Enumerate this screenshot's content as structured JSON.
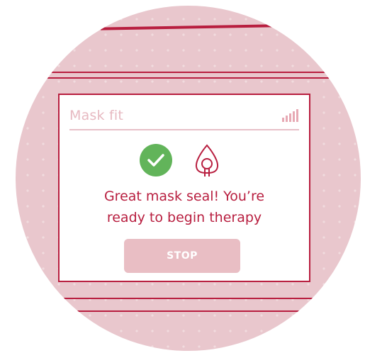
{
  "colors": {
    "accent": "#b81e3f",
    "success": "#62b45a",
    "backdrop": "#e9c7cd",
    "button_bg": "#e9bec4"
  },
  "panel": {
    "title": "Mask fit",
    "signal_icon": "signal-strength-icon",
    "status_icon": "check-circle-icon",
    "mask_icon": "mask-icon",
    "message_line1": "Great mask seal! You’re",
    "message_line2": "ready to begin therapy",
    "stop_label": "STOP"
  }
}
